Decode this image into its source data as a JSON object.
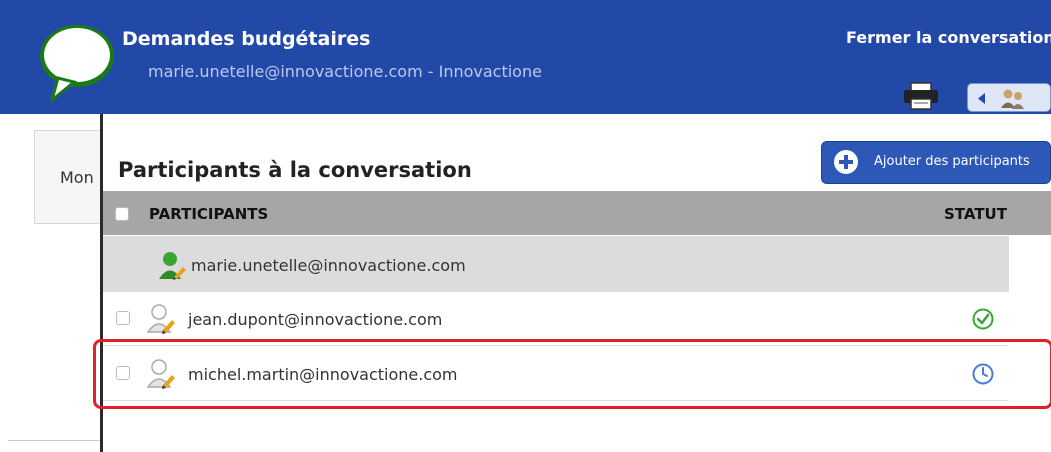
{
  "header": {
    "title": "Demandes budgétaires",
    "subtitle": "marie.unetelle@innovactione.com - Innovactione",
    "close_label": "Fermer la conversation"
  },
  "background": {
    "panel_text": "Mon"
  },
  "modal": {
    "title": "Participants à la conversation",
    "add_button_label": "Ajouter des participants",
    "columns": {
      "participants": "PARTICIPANTS",
      "status": "STATUT"
    },
    "rows": [
      {
        "email": "marie.unetelle@innovactione.com",
        "icon": "user-green-edit-icon",
        "status": ""
      },
      {
        "email": "jean.dupont@innovactione.com",
        "icon": "user-grey-edit-icon",
        "status": "accepted-check-icon"
      },
      {
        "email": "michel.martin@innovactione.com",
        "icon": "user-grey-edit-icon",
        "status": "pending-clock-icon"
      }
    ]
  },
  "colors": {
    "header_bg": "#2349a8",
    "button_bg": "#2d58b8",
    "check_green": "#3aa534",
    "clock_blue": "#4a7ad8",
    "highlight_red": "#e0202a"
  }
}
